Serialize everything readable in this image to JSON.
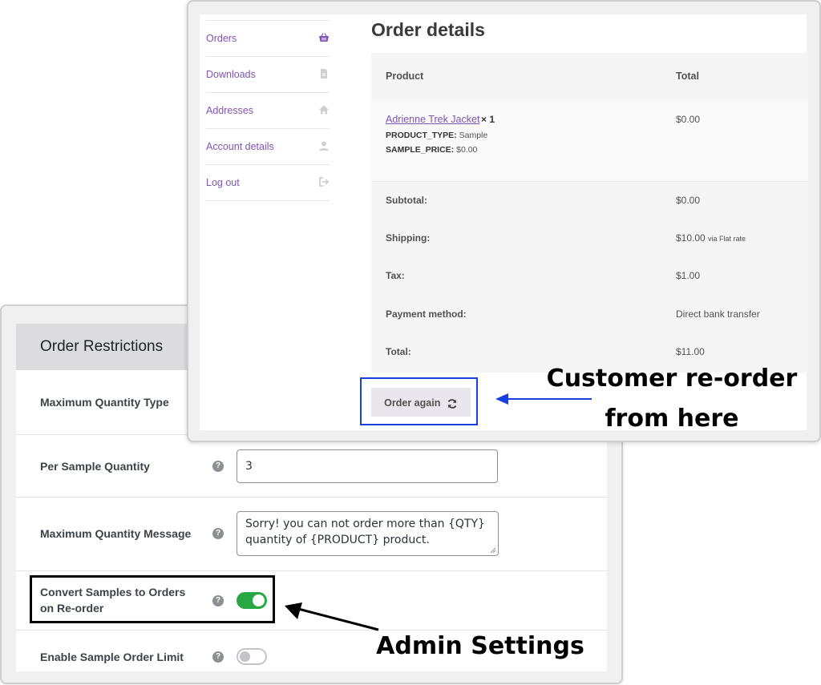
{
  "admin": {
    "title": "Order Restrictions",
    "rows": [
      {
        "label": "Maximum Quantity Type"
      },
      {
        "label": "Per Sample Quantity",
        "value": "3"
      },
      {
        "label": "Maximum Quantity Message",
        "value": "Sorry! you can not order more than {QTY} quantity of {PRODUCT} product."
      },
      {
        "label_line1": "Convert Samples to Orders",
        "label_line2": "on Re-order",
        "toggle": "on"
      },
      {
        "label": "Enable Sample Order Limit",
        "toggle": "off"
      }
    ],
    "help_glyph": "?"
  },
  "account_nav": {
    "items": [
      {
        "label": "Orders",
        "icon": "basket-icon"
      },
      {
        "label": "Downloads",
        "icon": "file-icon"
      },
      {
        "label": "Addresses",
        "icon": "home-icon"
      },
      {
        "label": "Account details",
        "icon": "user-icon"
      },
      {
        "label": "Log out",
        "icon": "sign-out-icon"
      }
    ]
  },
  "order": {
    "title": "Order details",
    "headers": {
      "product": "Product",
      "total": "Total"
    },
    "item": {
      "name": "Adrienne Trek Jacket",
      "qty": "× 1",
      "meta": [
        {
          "key": "PRODUCT_TYPE:",
          "value": "Sample"
        },
        {
          "key": "SAMPLE_PRICE:",
          "value": "$0.00"
        }
      ],
      "total": "$0.00"
    },
    "totals": [
      {
        "label": "Subtotal:",
        "value": "$0.00",
        "note": ""
      },
      {
        "label": "Shipping:",
        "value": "$10.00",
        "note": "via Flat rate"
      },
      {
        "label": "Tax:",
        "value": "$1.00",
        "note": ""
      },
      {
        "label": "Payment method:",
        "value": "Direct bank transfer",
        "note": ""
      },
      {
        "label": "Total:",
        "value": "$11.00",
        "note": ""
      }
    ],
    "order_again_label": "Order again"
  },
  "annotations": {
    "customer_line1": "Customer re-order",
    "customer_line2": "from here",
    "admin": "Admin Settings"
  },
  "colors": {
    "link_purple": "#7f54b3",
    "toggle_on_green": "#28a745",
    "highlight_blue": "#1740e0"
  }
}
